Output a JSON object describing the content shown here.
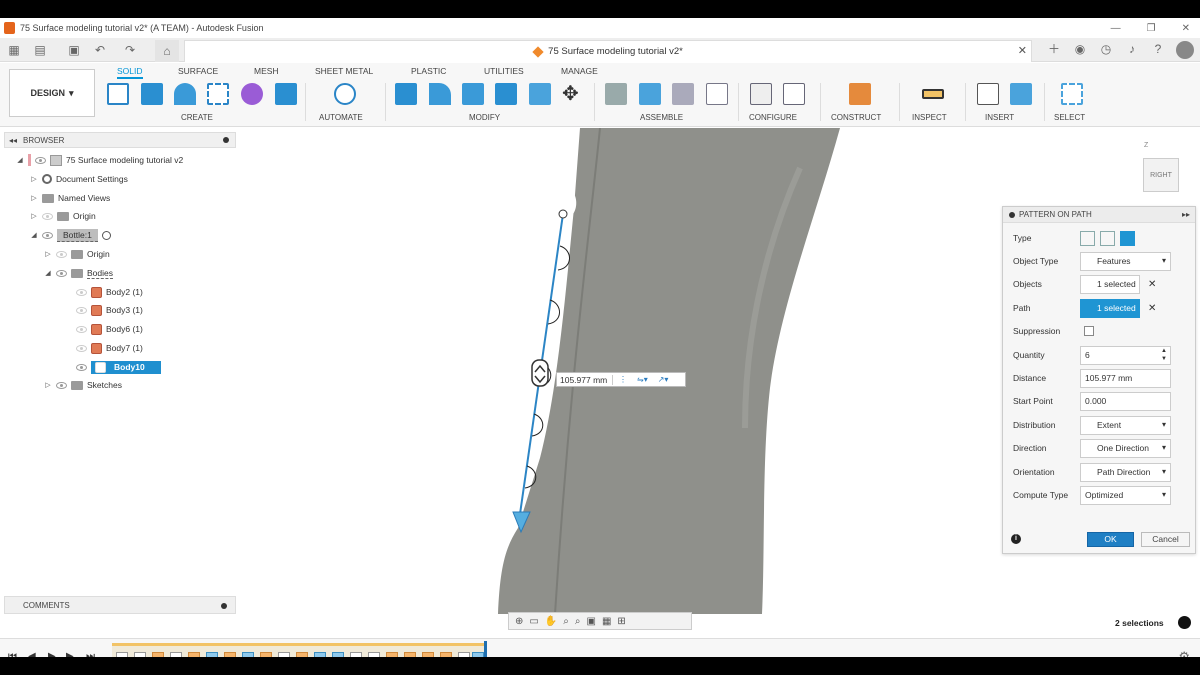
{
  "window": {
    "title": "75 Surface modeling tutorial v2* (A TEAM) - Autodesk Fusion"
  },
  "doc_tab": {
    "title": "75 Surface modeling tutorial v2*"
  },
  "workspace": {
    "label": "DESIGN"
  },
  "ribbon": {
    "tabs": [
      "SOLID",
      "SURFACE",
      "MESH",
      "SHEET METAL",
      "PLASTIC",
      "UTILITIES",
      "MANAGE"
    ],
    "active_tab": "SOLID",
    "groups": [
      "CREATE",
      "AUTOMATE",
      "MODIFY",
      "ASSEMBLE",
      "CONFIGURE",
      "CONSTRUCT",
      "INSPECT",
      "INSERT",
      "SELECT"
    ]
  },
  "browser": {
    "title": "BROWSER",
    "items": [
      {
        "label": "75 Surface modeling tutorial v2"
      },
      {
        "label": "Document Settings"
      },
      {
        "label": "Named Views"
      },
      {
        "label": "Origin"
      },
      {
        "label": "Bottle:1"
      },
      {
        "label": "Origin"
      },
      {
        "label": "Bodies"
      },
      {
        "label": "Body2 (1)"
      },
      {
        "label": "Body3 (1)"
      },
      {
        "label": "Body6 (1)"
      },
      {
        "label": "Body7 (1)"
      },
      {
        "label": "Body10"
      },
      {
        "label": "Sketches"
      }
    ]
  },
  "comments": {
    "title": "COMMENTS"
  },
  "viewcube": {
    "face": "RIGHT",
    "axis": "Z"
  },
  "dimension": {
    "value": "105.977 mm"
  },
  "dialog": {
    "title": "PATTERN ON PATH",
    "type_label": "Type",
    "object_type_label": "Object Type",
    "object_type": "Features",
    "objects_label": "Objects",
    "objects": "1 selected",
    "path_label": "Path",
    "path": "1 selected",
    "suppression_label": "Suppression",
    "quantity_label": "Quantity",
    "quantity": "6",
    "distance_label": "Distance",
    "distance": "105.977 mm",
    "start_point_label": "Start Point",
    "start_point": "0.000",
    "distribution_label": "Distribution",
    "distribution": "Extent",
    "direction_label": "Direction",
    "direction": "One Direction",
    "orientation_label": "Orientation",
    "orientation": "Path Direction",
    "compute_type_label": "Compute Type",
    "compute_type": "Optimized",
    "ok": "OK",
    "cancel": "Cancel"
  },
  "status": {
    "selections": "2 selections"
  },
  "colors": {
    "accent": "#0696d7",
    "selection": "#1f95d3",
    "model": "#8d8e89"
  }
}
